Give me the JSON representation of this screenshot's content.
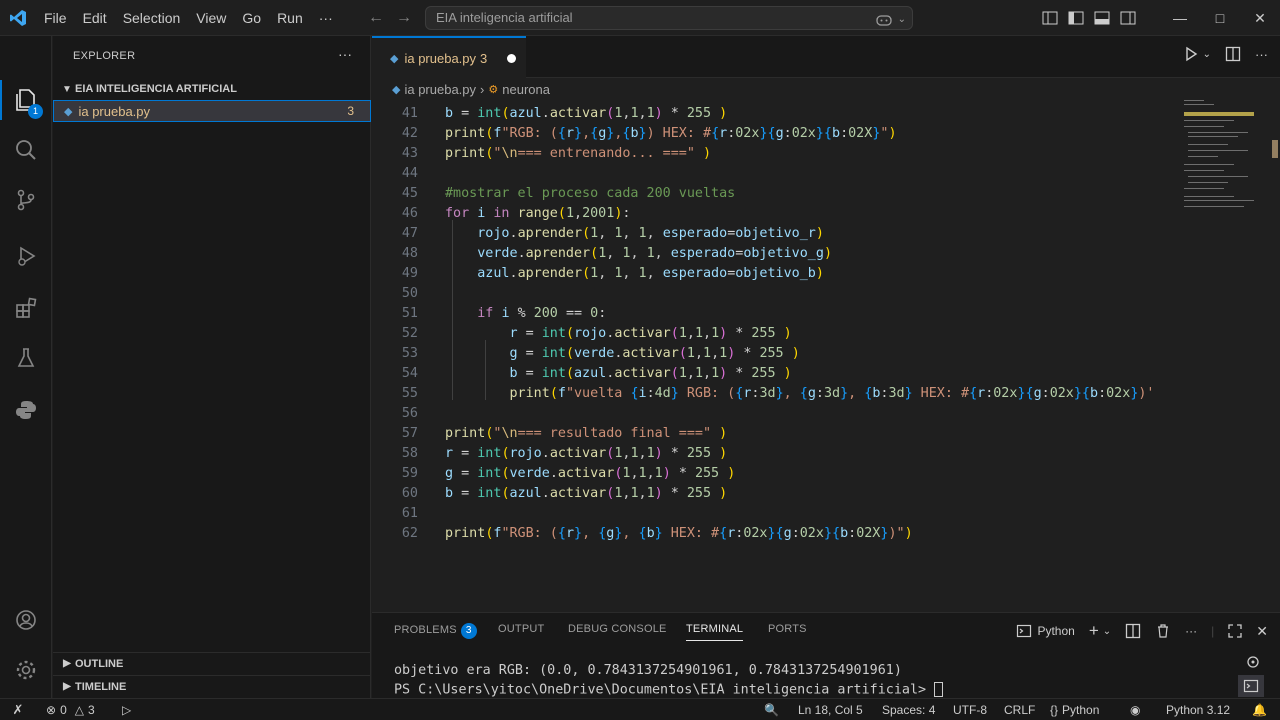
{
  "titlebar": {
    "menu": [
      "File",
      "Edit",
      "Selection",
      "View",
      "Go",
      "Run",
      "···"
    ],
    "search_text": "EIA inteligencia artificial"
  },
  "activity": {
    "explorer_badge": "1"
  },
  "sidebar": {
    "title": "EXPLORER",
    "more": "···",
    "folder": "EIA INTELIGENCIA ARTIFICIAL",
    "file": {
      "name": "ia prueba.py",
      "problems": "3"
    },
    "outline": "OUTLINE",
    "timeline": "TIMELINE"
  },
  "tab": {
    "name": "ia prueba.py",
    "problems": "3"
  },
  "breadcrumb": {
    "file": "ia prueba.py",
    "symbol": "neurona",
    "sep": "›"
  },
  "editor": {
    "line_numbers": [
      "41",
      "42",
      "43",
      "44",
      "45",
      "46",
      "47",
      "48",
      "49",
      "50",
      "51",
      "52",
      "53",
      "54",
      "55",
      "56",
      "57",
      "58",
      "59",
      "60",
      "61",
      "62"
    ]
  },
  "panel": {
    "tabs": {
      "problems": "PROBLEMS",
      "output": "OUTPUT",
      "debug": "DEBUG CONSOLE",
      "terminal": "TERMINAL",
      "ports": "PORTS"
    },
    "problems_count": "3",
    "shell": "Python",
    "terminal_lines": [
      "objetivo era RGB: (0.0, 0.7843137254901961, 0.7843137254901961)",
      "PS C:\\Users\\yitoc\\OneDrive\\Documentos\\EIA inteligencia artificial> "
    ]
  },
  "status": {
    "errors": "0",
    "warnings": "3",
    "position": "Ln 18, Col 5",
    "spaces": "Spaces: 4",
    "encoding": "UTF-8",
    "eol": "CRLF",
    "language": "Python",
    "interpreter": "Python 3.12",
    "braces": "{}"
  }
}
